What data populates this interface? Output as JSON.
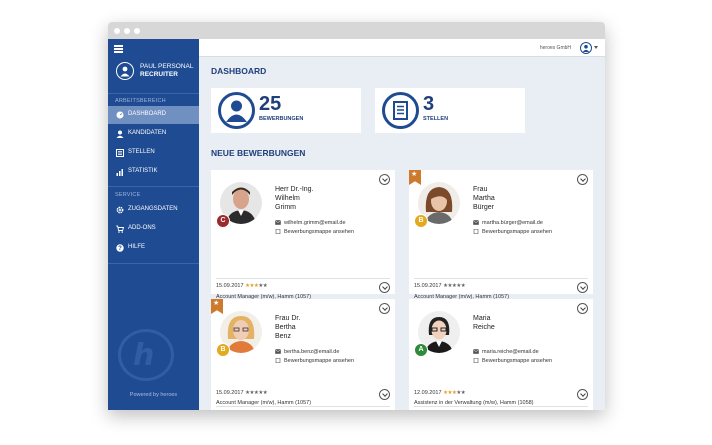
{
  "sidebar": {
    "profile": {
      "name": "PAUL PERSONAL",
      "role": "RECRUITER"
    },
    "section1": "ARBEITSBEREICH",
    "section2": "SERVICE",
    "items": [
      {
        "label": "DASHBOARD",
        "icon": "dashboard-icon",
        "active": true
      },
      {
        "label": "KANDIDATEN",
        "icon": "user-icon"
      },
      {
        "label": "STELLEN",
        "icon": "list-icon"
      },
      {
        "label": "STATISTIK",
        "icon": "bar-chart-icon"
      }
    ],
    "service_items": [
      {
        "label": "ZUGANGSDATEN",
        "icon": "gear-icon"
      },
      {
        "label": "ADD-ONS",
        "icon": "cart-icon"
      },
      {
        "label": "HILFE",
        "icon": "help-icon"
      }
    ],
    "powered": "Powered by heroes"
  },
  "topbar": {
    "company": "heroes GmbH"
  },
  "main": {
    "title": "DASHBOARD",
    "stats": [
      {
        "number": "25",
        "label": "BEWERBUNGEN",
        "icon": "user-circle-icon"
      },
      {
        "number": "3",
        "label": "STELLEN",
        "icon": "document-list-icon"
      }
    ],
    "section_title": "NEUE BEWERBUNGEN",
    "link_label": "Bewerbungsmappe ansehen",
    "cards": [
      {
        "lines": [
          "Herr Dr.-Ing.",
          "Wilhelm",
          "Grimm"
        ],
        "email": "wilhelm.grimm@email.de",
        "grade": "C",
        "grade_color": "#9c2a2a",
        "date": "15.09.2017",
        "rating": 3,
        "position": "Account Manager (m/w), Hamm (1057)",
        "favorite": false
      },
      {
        "lines": [
          "Frau",
          "Martha",
          "Bürger"
        ],
        "email": "martha.bürger@email.de",
        "grade": "B",
        "grade_color": "#e3a91f",
        "date": "15.09.2017",
        "rating": 0,
        "position": "Account Manager (m/w), Hamm (1057)",
        "favorite": true,
        "favorite_icon": "star-icon"
      },
      {
        "lines": [
          "Frau Dr.",
          "Bertha",
          "Benz"
        ],
        "email": "bertha.benz@email.de",
        "grade": "B",
        "grade_color": "#e3a91f",
        "date": "15.09.2017",
        "rating": 0,
        "position": "Account Manager (m/w), Hamm (1057)",
        "favorite": true,
        "favorite_icon": "star-icon"
      },
      {
        "lines": [
          "Maria",
          "Reiche"
        ],
        "email": "maria.reiche@email.de",
        "grade": "A",
        "grade_color": "#2f8a3a",
        "date": "12.09.2017",
        "rating": 3,
        "position": "Assistenz in der Verwaltung (m/w), Hamm (1058)",
        "favorite": false
      }
    ]
  },
  "colors": {
    "brand": "#1f4b93",
    "accent": "#cd7a2c",
    "star": "#e2a028"
  }
}
